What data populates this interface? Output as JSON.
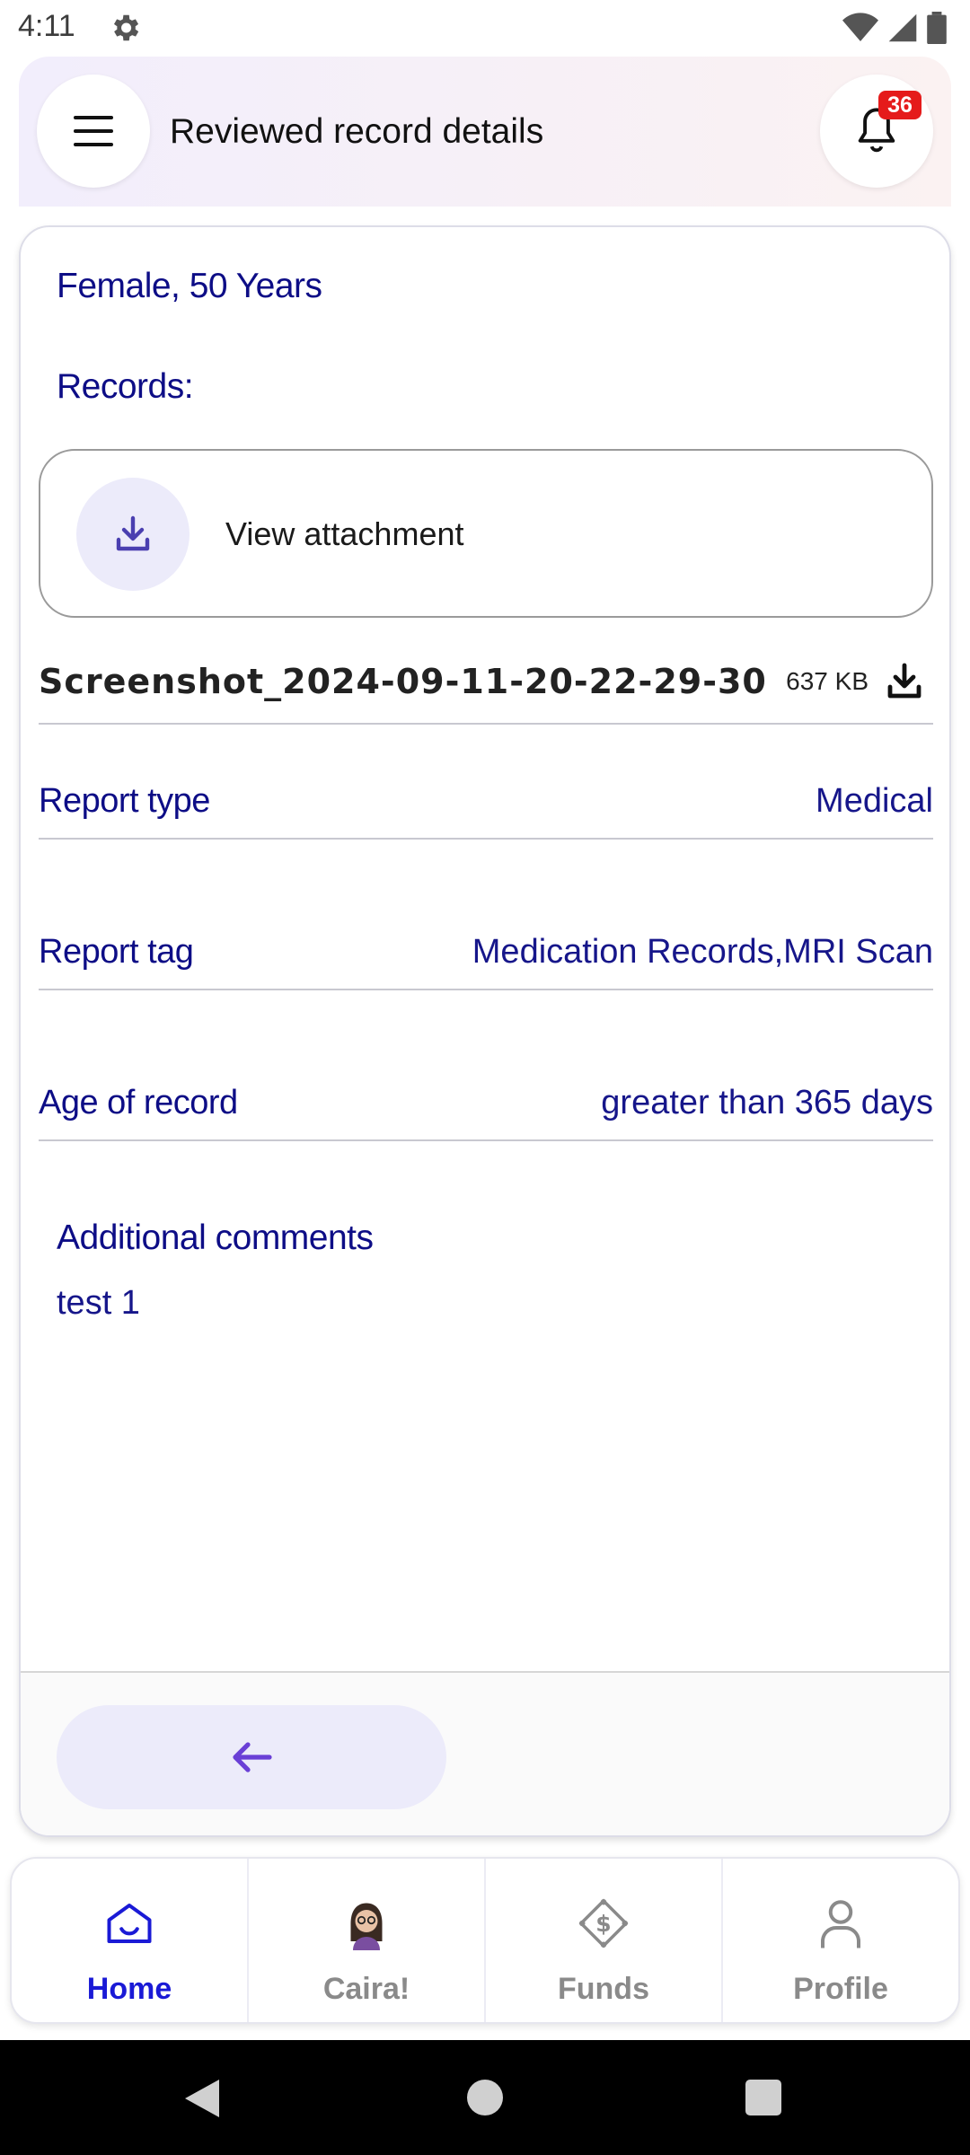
{
  "status_bar": {
    "time": "4:11"
  },
  "header": {
    "title": "Reviewed record details",
    "notification_count": "36"
  },
  "card": {
    "patient_summary": "Female, 50 Years",
    "records_label": "Records:",
    "attachment_label": "View attachment",
    "file": {
      "name": "Screenshot_2024-09-11-20-22-29-30",
      "size": "637 KB"
    },
    "rows": [
      {
        "key": "Report type",
        "value": "Medical"
      },
      {
        "key": "Report tag",
        "value": "Medication Records,MRI Scan"
      },
      {
        "key": "Age of record",
        "value": "greater than 365 days"
      }
    ],
    "comments_label": "Additional comments",
    "comments_value": "test 1"
  },
  "bottom_nav": {
    "items": [
      {
        "label": "Home",
        "icon": "home-icon",
        "active": true
      },
      {
        "label": "Caira!",
        "icon": "caira-avatar-icon",
        "active": false
      },
      {
        "label": "Funds",
        "icon": "funds-icon",
        "active": false
      },
      {
        "label": "Profile",
        "icon": "profile-icon",
        "active": false
      }
    ]
  },
  "colors": {
    "accent": "#1a1ad6",
    "label_navy": "#0d0d86",
    "badge_red": "#e51b1b",
    "soft_lavender": "#ecebfa",
    "arrow_purple": "#6a3fd6"
  }
}
